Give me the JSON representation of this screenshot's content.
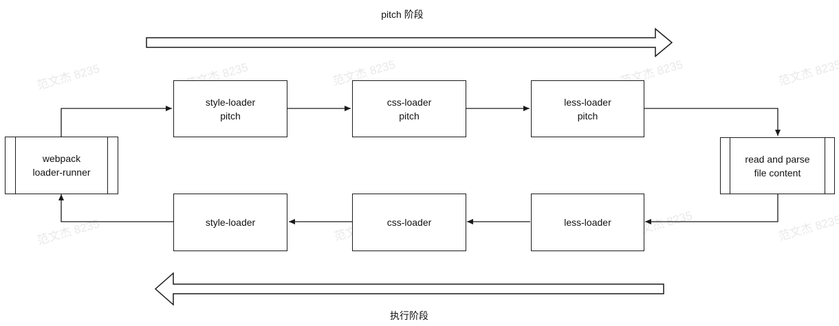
{
  "stages": {
    "pitch_label": "pitch 阶段",
    "exec_label": "执行阶段"
  },
  "nodes": {
    "runner": "webpack\nloader-runner",
    "style_pitch": "style-loader\npitch",
    "css_pitch": "css-loader\npitch",
    "less_pitch": "less-loader\npitch",
    "read_parse": "read and parse\nfile content",
    "style_exec": "style-loader",
    "css_exec": "css-loader",
    "less_exec": "less-loader"
  },
  "watermark": "范文杰 8235",
  "colors": {
    "stroke": "#1a1a1a",
    "watermark": "#e9e9e9"
  }
}
